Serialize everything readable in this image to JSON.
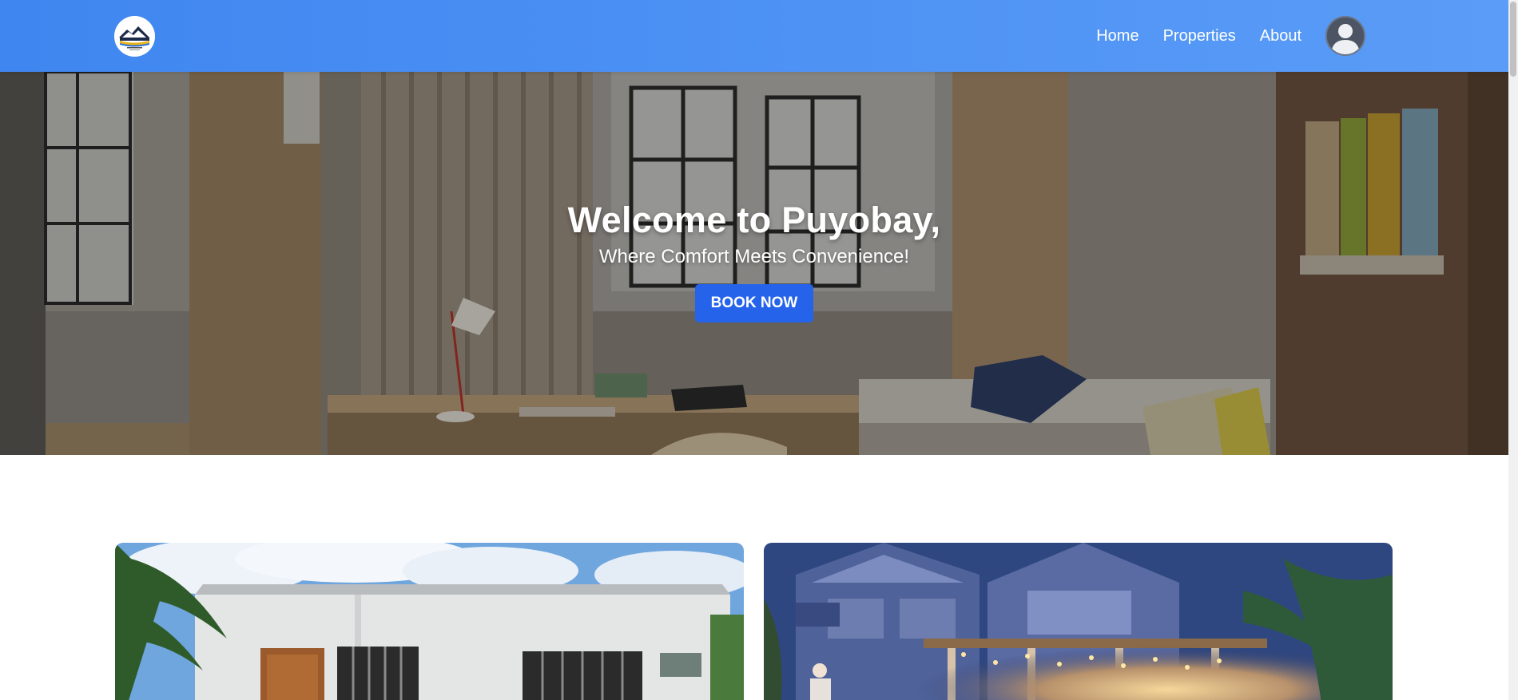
{
  "navbar": {
    "logo_icon": "puyobay-logo-icon",
    "links": [
      {
        "label": "Home"
      },
      {
        "label": "Properties"
      },
      {
        "label": "About"
      }
    ],
    "avatar_icon": "user-avatar-icon",
    "colors": {
      "start": "#3f86f0",
      "end": "#5a9cf7"
    }
  },
  "hero": {
    "title": "Welcome to Puyobay,",
    "subtitle": "Where Comfort Meets Convenience!",
    "cta_label": "BOOK NOW",
    "cta_color": "#2563eb"
  },
  "properties": {
    "cards": [
      {
        "icon": "property-photo-daytime-house"
      },
      {
        "icon": "property-photo-evening-house"
      }
    ]
  }
}
